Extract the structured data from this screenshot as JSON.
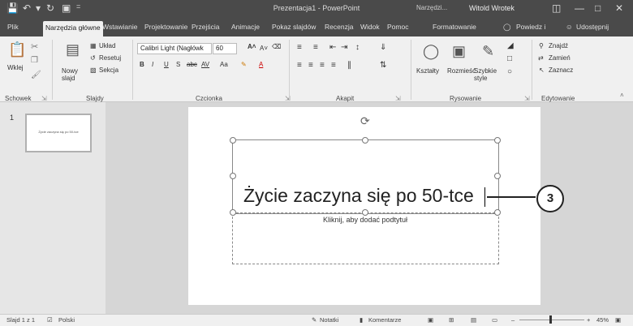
{
  "titlebar": {
    "title": "Prezentacja1 - PowerPoint",
    "context": "Narzędzi...",
    "user": "Witold Wrotek",
    "qa_icons": [
      "save-icon",
      "undo-icon",
      "redo-icon",
      "present-icon",
      "customize-icon"
    ],
    "window_buttons": [
      "ribbon-display-icon",
      "minimize-icon",
      "maximize-icon",
      "close-icon"
    ]
  },
  "tabs": [
    "Plik",
    "Narzędzia główne",
    "Wstawianie",
    "Projektowanie",
    "Przejścia",
    "Animacje",
    "Pokaz slajdów",
    "Recenzja",
    "Widok",
    "Pomoc",
    "Formatowanie",
    "Powiedz i",
    "Udostępnij"
  ],
  "active_tab": "Narzędzia główne",
  "ribbon": {
    "clipboard": {
      "paste": "Wklej",
      "label": "Schowek"
    },
    "slides": {
      "new_slide": "Nowy slajd",
      "layout": "Układ",
      "reset": "Resetuj",
      "section": "Sekcja",
      "label": "Slajdy"
    },
    "font": {
      "font_name": "Calibri Light (Nagłówk",
      "font_size": "60",
      "change_case": "Aa",
      "bold": "B",
      "italic": "I",
      "underline": "U",
      "shadow": "S",
      "strike": "abc",
      "spacing": "AV",
      "label": "Czcionka"
    },
    "paragraph": {
      "label": "Akapit"
    },
    "drawing": {
      "shapes": "Kształty",
      "arrange": "Rozmieść",
      "quick_styles": "Szybkie style",
      "label": "Rysowanie"
    },
    "editing": {
      "find": "Znajdź",
      "replace": "Zamień",
      "select": "Zaznacz",
      "label": "Edytowanie"
    }
  },
  "slide_thumbnail": {
    "number": "1",
    "text": "Życie zaczyna się po 50-tce"
  },
  "slide": {
    "title": "Życie zaczyna się po 50-tce",
    "subtitle_placeholder": "Kliknij, aby dodać podtytuł"
  },
  "callout": "3",
  "statusbar": {
    "slide_info": "Slajd 1 z 1",
    "language": "Polski",
    "notes": "Notatki",
    "comments": "Komentarze",
    "zoom": "45%"
  }
}
